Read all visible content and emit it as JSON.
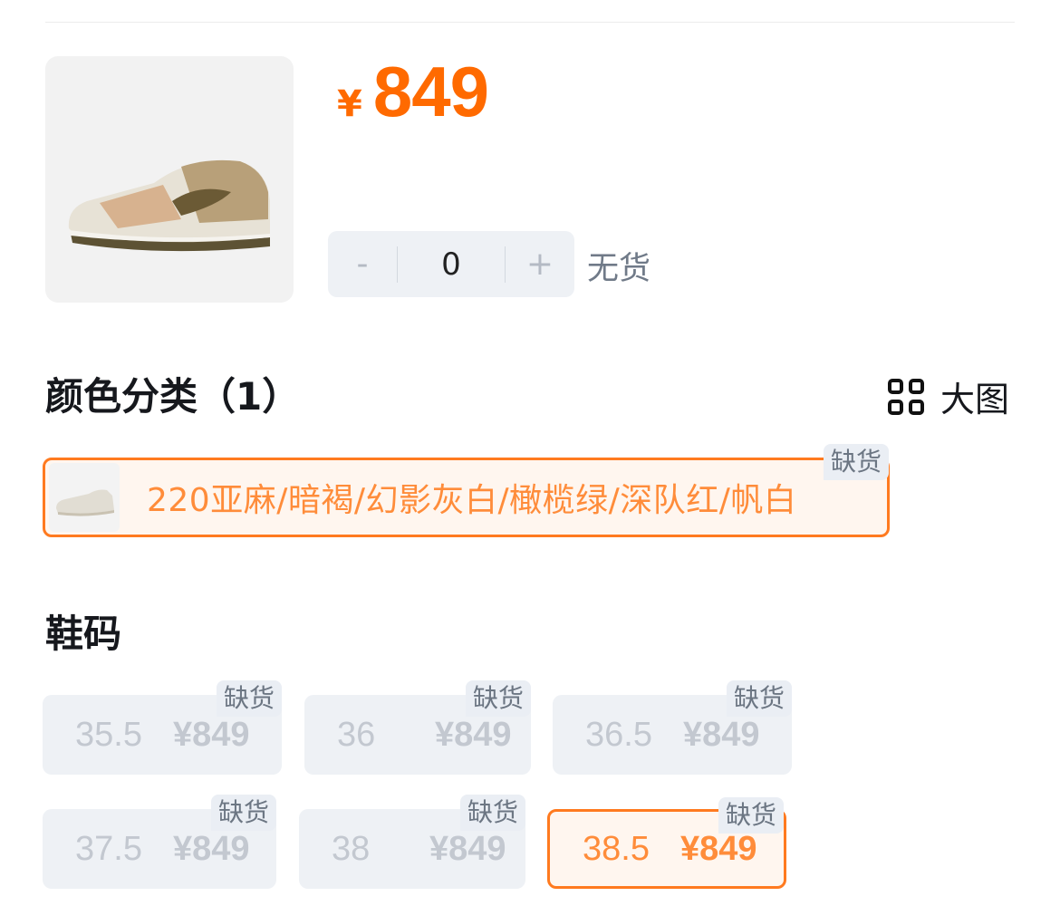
{
  "product": {
    "price_currency": "¥",
    "price_amount": "849",
    "image_icon": "sneaker-image"
  },
  "quantity": {
    "decrement_label": "-",
    "value": "0",
    "increment_label": "+",
    "stock_status": "无货"
  },
  "color_section": {
    "title": "颜色分类（1）",
    "big_image_label": "大图",
    "options": [
      {
        "label": "220亚麻/暗褐/幻影灰白/橄榄绿/深队红/帆白",
        "badge": "缺货",
        "selected": true
      }
    ]
  },
  "size_section": {
    "title": "鞋码",
    "options": [
      {
        "size": "35.5",
        "price": "¥849",
        "badge": "缺货",
        "selected": false
      },
      {
        "size": "36",
        "price": "¥849",
        "badge": "缺货",
        "selected": false
      },
      {
        "size": "36.5",
        "price": "¥849",
        "badge": "缺货",
        "selected": false
      },
      {
        "size": "37.5",
        "price": "¥849",
        "badge": "缺货",
        "selected": false
      },
      {
        "size": "38",
        "price": "¥849",
        "badge": "缺货",
        "selected": false
      },
      {
        "size": "38.5",
        "price": "¥849",
        "badge": "缺货",
        "selected": true
      }
    ]
  },
  "colors": {
    "accent": "#ff6a00",
    "selected_border": "#ff7a1f",
    "chip_bg": "#eef1f5"
  }
}
